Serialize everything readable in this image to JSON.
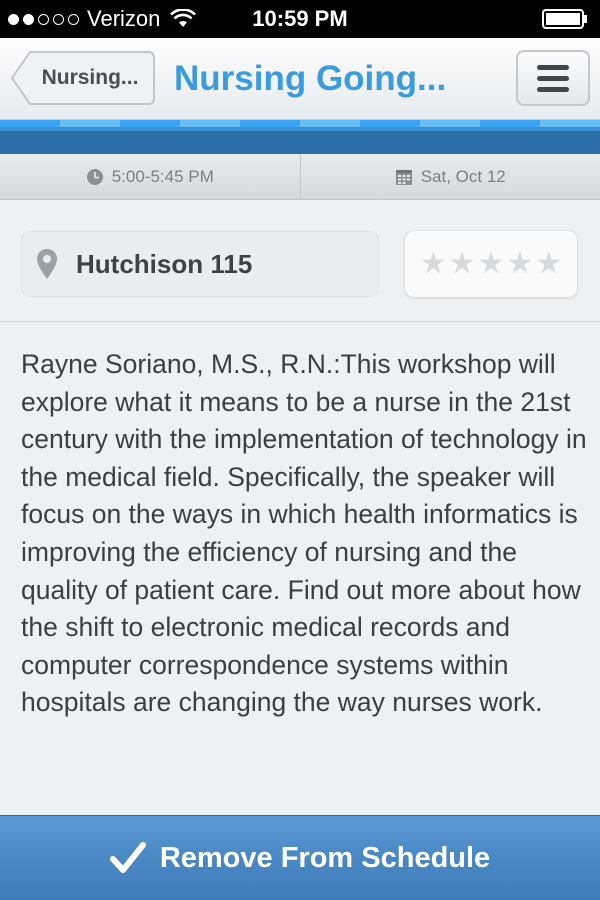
{
  "status_bar": {
    "carrier": "Verizon",
    "time": "10:59 PM",
    "signal_bars_filled": 2,
    "signal_bars_total": 5
  },
  "nav": {
    "back_label": "Nursing...",
    "title": "Nursing Going..."
  },
  "session": {
    "time": "5:00-5:45 PM",
    "date": "Sat, Oct 12",
    "location": "Hutchison 115",
    "rating": 0,
    "rating_max": 5,
    "description": "Rayne Soriano, M.S., R.N.:This workshop will explore what it means to be a nurse in the 21st century with the implementation of technology in the medical field. Specifically, the speaker will focus on the ways in which health informatics is improving the efficiency of nursing and the quality of patient care. Find out more about how the shift to electronic medical records and computer correspondence systems within hospitals are changing the way nurses work."
  },
  "action": {
    "label": "Remove From Schedule"
  },
  "colors": {
    "title_blue": "#3a9be0",
    "action_blue": "#4a89c6",
    "stripe_blue": "#2b6fa6"
  },
  "icons": {
    "wifi": "wifi-icon",
    "battery": "battery-icon",
    "menu": "hamburger-menu-icon",
    "clock": "clock-icon",
    "calendar": "calendar-icon",
    "pin": "location-pin-icon",
    "star": "star-icon",
    "check": "checkmark-icon"
  }
}
